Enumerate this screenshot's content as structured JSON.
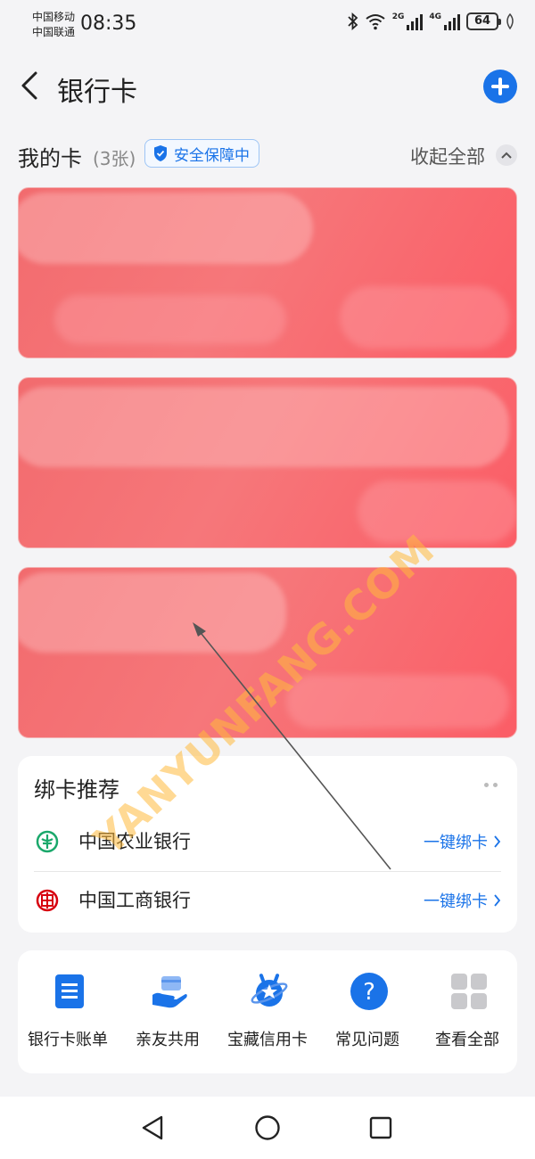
{
  "status_bar": {
    "carrier1": "中国移动",
    "carrier2": "中国联通",
    "time": "08:35",
    "net1": "2G",
    "net2": "4G",
    "battery": "64"
  },
  "header": {
    "title": "银行卡"
  },
  "my_cards": {
    "title": "我的卡",
    "count": "(3张)",
    "safety_badge": "安全保障中",
    "collapse_label": "收起全部"
  },
  "recommend": {
    "title": "绑卡推荐",
    "banks": [
      {
        "name": "中国农业银行",
        "action": "一键绑卡",
        "logo_icon": "abc-bank-logo-icon",
        "color": "#1aa86b"
      },
      {
        "name": "中国工商银行",
        "action": "一键绑卡",
        "logo_icon": "icbc-bank-logo-icon",
        "color": "#d7000f"
      }
    ]
  },
  "shortcuts": [
    {
      "label": "银行卡账单",
      "icon": "bill-icon"
    },
    {
      "label": "亲友共用",
      "icon": "share-card-icon"
    },
    {
      "label": "宝藏信用卡",
      "icon": "credit-card-planet-icon"
    },
    {
      "label": "常见问题",
      "icon": "question-icon"
    },
    {
      "label": "查看全部",
      "icon": "grid-icon"
    }
  ],
  "watermark": "YANYUNFANG.COM",
  "colors": {
    "accent": "#1a73e8",
    "card": "#f56b70"
  }
}
